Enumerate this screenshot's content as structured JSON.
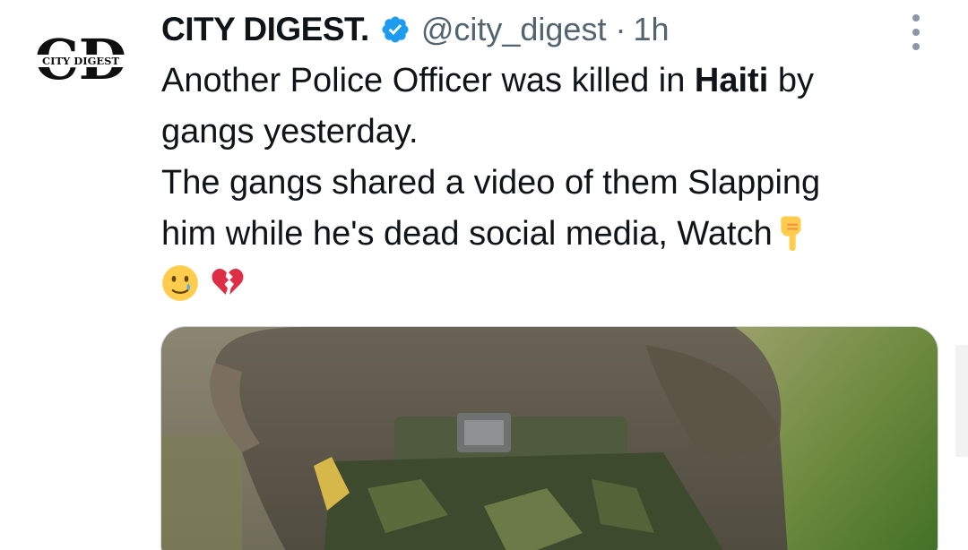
{
  "tweet": {
    "display_name": "CITY DIGEST.",
    "handle": "@city_digest",
    "separator": "·",
    "time": "1h",
    "avatar": {
      "logo_text": "CD",
      "logo_subtext": "CITY DIGEST"
    },
    "body": {
      "line1_pre": "Another Police Officer was killed in ",
      "line1_bold": "Haiti",
      "line1_post": " by",
      "line2": "gangs yesterday.",
      "line3": "The gangs shared a video of them Slapping",
      "line4": "him while he's dead social media, Watch"
    },
    "icons": {
      "verified": "verified-badge-icon",
      "more": "more-options-icon",
      "pointing_down": "backhand-index-pointing-down-emoji",
      "crying_face": "smiling-face-with-tear-emoji",
      "broken_heart": "broken-heart-emoji"
    },
    "media": {
      "type": "video-thumbnail"
    }
  },
  "colors": {
    "text_primary": "#0f1419",
    "text_secondary": "#536471",
    "verified_blue": "#1d9bf0"
  }
}
